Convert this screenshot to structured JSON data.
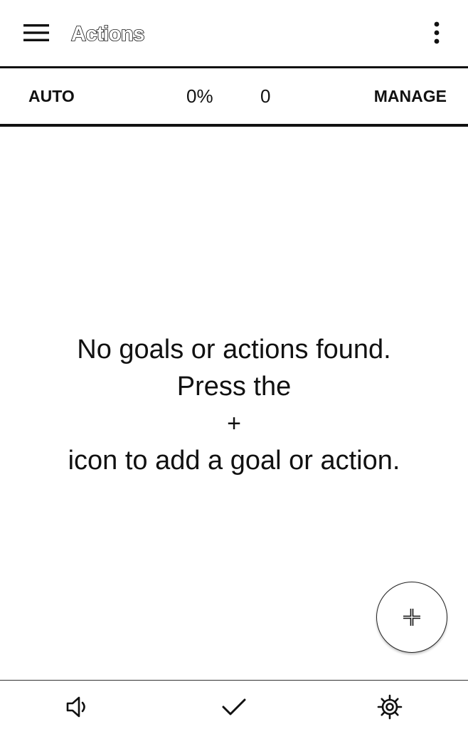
{
  "appbar": {
    "title": "Actions",
    "menu_icon": "hamburger-menu-icon",
    "overflow_icon": "more-vertical-icon"
  },
  "status": {
    "auto_label": "AUTO",
    "percent": "0%",
    "count": "0",
    "manage_label": "MANAGE"
  },
  "empty_state": {
    "line1": "No goals or actions found.",
    "line2": "Press the",
    "plus": "+",
    "line3": "icon to add a goal or action."
  },
  "fab": {
    "icon": "add-icon"
  },
  "bottom_nav": [
    {
      "name": "sound",
      "icon": "speaker-icon"
    },
    {
      "name": "complete",
      "icon": "check-icon"
    },
    {
      "name": "settings",
      "icon": "settings-gear-icon"
    }
  ],
  "colors": {
    "background": "#ffffff",
    "foreground": "#111111"
  }
}
